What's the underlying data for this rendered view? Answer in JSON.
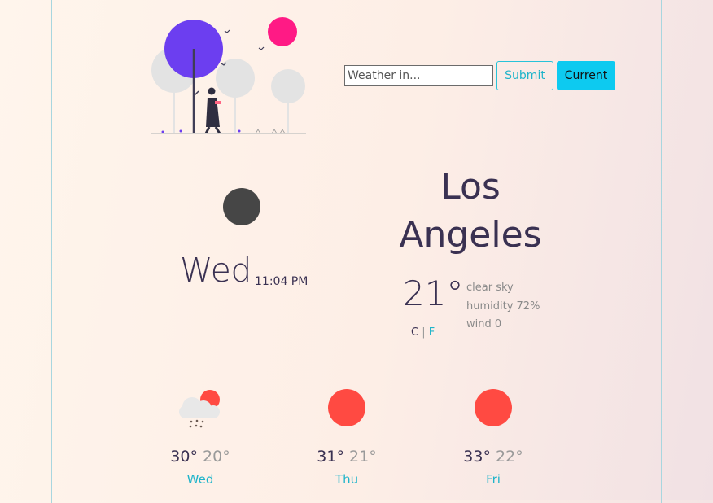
{
  "search": {
    "placeholder": "Weather in...",
    "submit_label": "Submit",
    "current_label": "Current"
  },
  "current": {
    "icon": "moon-icon",
    "day": "Wed",
    "time": "11:04 PM",
    "city": "Los Angeles",
    "temperature": "21°",
    "unit_c": "C",
    "unit_sep": "|",
    "unit_f": "F",
    "description": "clear sky",
    "humidity": "humidity 72%",
    "wind": "wind 0"
  },
  "forecast": [
    {
      "icon": "rain-cloud-icon",
      "high": "30°",
      "low": "20°",
      "day": "Wed"
    },
    {
      "icon": "sun-icon",
      "high": "31°",
      "low": "21°",
      "day": "Thu"
    },
    {
      "icon": "sun-icon",
      "high": "33°",
      "low": "22°",
      "day": "Fri"
    }
  ],
  "colors": {
    "accent": "#0dcaf0",
    "link": "#1fb4ca",
    "text": "#3a3152",
    "muted": "#8a8a8a",
    "sun": "#ff4a42",
    "moon": "#464646",
    "illustration_purple": "#6c3ef0",
    "illustration_pink": "#ff1a85"
  }
}
